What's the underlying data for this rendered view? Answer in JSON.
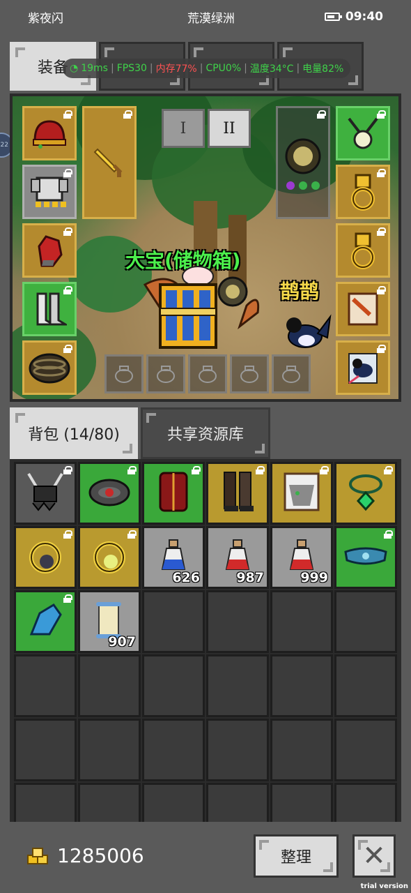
{
  "status": {
    "player": "紫夜闪",
    "zone": "荒漠绿洲",
    "time": "09:40"
  },
  "top_tabs": [
    {
      "label": "装备",
      "active": true
    },
    {
      "label": "",
      "active": false
    },
    {
      "label": "",
      "active": false
    },
    {
      "label": "",
      "active": false
    }
  ],
  "perf": {
    "ping": "19ms",
    "fps": "FPS30",
    "mem": "内存77%",
    "cpu": "CPU0%",
    "temp": "温度34°C",
    "battery": "电量82%"
  },
  "side_bubble": "22",
  "scene": {
    "page_buttons": [
      "I",
      "II"
    ],
    "character_name": "大宝(储物箱)",
    "pet_name": "鹊鹊"
  },
  "equip_slots": {
    "left": [
      {
        "item": "red-helmet-icon",
        "color": "gold"
      },
      {
        "item": "armor-icon",
        "color": "gray"
      },
      {
        "item": "red-gauntlet-icon",
        "color": "gold"
      },
      {
        "item": "boots-icon",
        "color": "green"
      },
      {
        "item": "belt-icon",
        "color": "gold"
      }
    ],
    "weapon": "sword-icon",
    "offhand": "shield-icon",
    "right": [
      {
        "item": "amulet-icon",
        "color": "green"
      },
      {
        "item": "ring-icon",
        "color": "gold"
      },
      {
        "item": "ring-icon",
        "color": "gold"
      },
      {
        "item": "scroll-icon",
        "color": "gold"
      },
      {
        "item": "magpie-icon",
        "color": "gold"
      }
    ],
    "bottom_count": 5
  },
  "backpack": {
    "tab_label": "背包 (14/80)",
    "shared_label": "共享资源库",
    "items": [
      {
        "icon": "horned-helmet-icon",
        "color": "darkgray",
        "locked": true,
        "count": ""
      },
      {
        "icon": "gem-belt-icon",
        "color": "green",
        "locked": true,
        "count": ""
      },
      {
        "icon": "red-chestplate-icon",
        "color": "green",
        "locked": true,
        "count": ""
      },
      {
        "icon": "dark-greaves-icon",
        "color": "gold",
        "locked": true,
        "count": ""
      },
      {
        "icon": "tiger-portrait-icon",
        "color": "gold",
        "locked": true,
        "count": ""
      },
      {
        "icon": "emerald-amulet-icon",
        "color": "gold",
        "locked": true,
        "count": ""
      },
      {
        "icon": "dark-ring-icon",
        "color": "gold",
        "locked": true,
        "count": ""
      },
      {
        "icon": "light-ring-icon",
        "color": "gold",
        "locked": true,
        "count": ""
      },
      {
        "icon": "blue-potion-icon",
        "color": "gray",
        "locked": false,
        "count": "626"
      },
      {
        "icon": "red-potion-icon",
        "color": "gray",
        "locked": false,
        "count": "987"
      },
      {
        "icon": "red-potion-icon",
        "color": "gray",
        "locked": false,
        "count": "999"
      },
      {
        "icon": "blue-belt-icon",
        "color": "green",
        "locked": true,
        "count": ""
      },
      {
        "icon": "blue-glove-icon",
        "color": "green",
        "locked": true,
        "count": ""
      },
      {
        "icon": "scroll-icon",
        "color": "gray",
        "locked": false,
        "count": "907"
      }
    ],
    "visible_slots": 36
  },
  "footer": {
    "gold": "1285006",
    "sort_label": "整理",
    "watermark": "trial version"
  },
  "colors": {
    "gold_slot": "#b99a2f",
    "green_slot": "#3aa83a",
    "gray_slot": "#9a9a9a",
    "name_green": "#4cf04c",
    "pet_name_yellow": "#f5d84a"
  }
}
